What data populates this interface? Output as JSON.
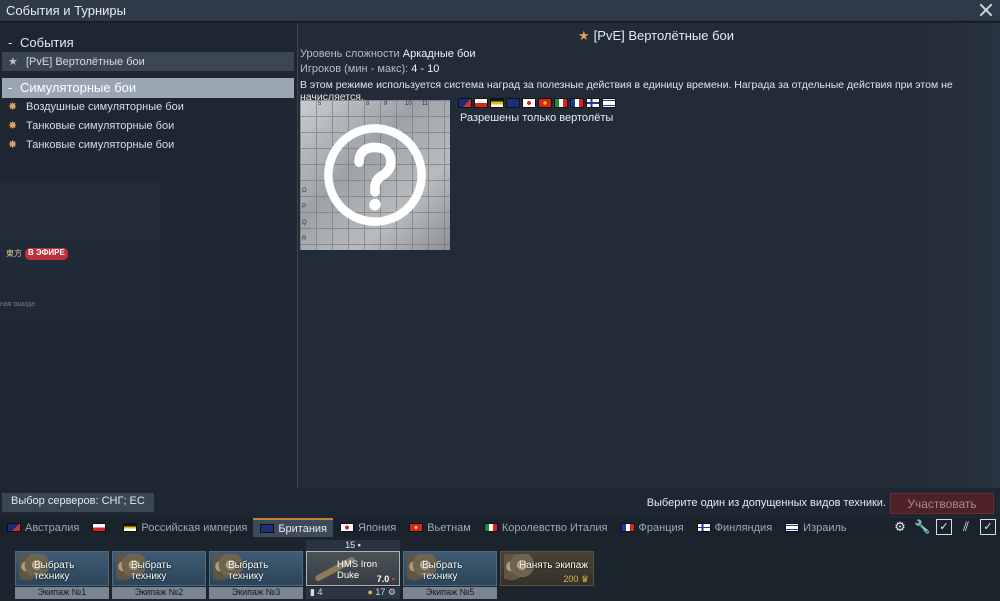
{
  "window": {
    "title": "События и Турниры"
  },
  "left_panel": {
    "sections": [
      {
        "label": "События",
        "items": [
          {
            "label": "[PvE] Вертолётные бои",
            "selected": true
          }
        ]
      },
      {
        "label": "Симуляторные бои",
        "active": true,
        "items": [
          {
            "label": "Воздушные симуляторные бои"
          },
          {
            "label": "Танковые симуляторные бои"
          },
          {
            "label": "Танковые симуляторные бои"
          }
        ]
      }
    ],
    "stream": {
      "brand": "東方",
      "status": "В ЭФИРЕ"
    },
    "error_text": "ная ошида"
  },
  "event": {
    "title": "[PvE] Вертолётные бои",
    "difficulty_label": "Уровень сложности",
    "difficulty_value": "Аркадные бои",
    "players_label": "Игроков (мин - макс):",
    "players_value": "4 - 10",
    "description": "В этом режиме используется система наград за полезные действия в единицу времени. Награда за отдельные действия при этом не начисляется.",
    "restriction": "Разрешены только вертолёты",
    "map_col_labels": [
      "5",
      "8",
      "9",
      "10",
      "11"
    ],
    "map_row_labels": [
      "O",
      "P",
      "Q",
      "R"
    ],
    "allowed_flags": [
      "australia",
      "poland",
      "russia-empire",
      "britain",
      "japan",
      "vietnam",
      "italy",
      "france",
      "finland",
      "israel"
    ]
  },
  "bottom": {
    "server_button": "Выбор серверов: СНГ; ЕС",
    "hint": "Выберите один из допущенных видов техники.",
    "participate_button": "Участвовать"
  },
  "nations": [
    {
      "label": "Австралия",
      "flag": "australia"
    },
    {
      "label": "",
      "flag": "poland"
    },
    {
      "label": "Российская империя",
      "flag": "russia-empire"
    },
    {
      "label": "Британия",
      "flag": "britain",
      "active": true
    },
    {
      "label": "Япония",
      "flag": "japan"
    },
    {
      "label": "Вьетнам",
      "flag": "vietnam"
    },
    {
      "label": "Королевство Италия",
      "flag": "italy"
    },
    {
      "label": "Франция",
      "flag": "france"
    },
    {
      "label": "Финляндия",
      "flag": "finland"
    },
    {
      "label": "Израиль",
      "flag": "israel"
    }
  ],
  "crew_slots": [
    {
      "type": "empty",
      "label": "Выбрать технику",
      "crew": "Экипаж №1"
    },
    {
      "type": "empty",
      "label": "Выбрать технику",
      "crew": "Экипаж №2"
    },
    {
      "type": "empty",
      "label": "Выбрать технику",
      "crew": "Экипаж №3"
    },
    {
      "type": "vehicle",
      "vehicle": "HMS Iron Duke",
      "badge": "15",
      "br": "7.0",
      "crew_num": "4",
      "stat": "17"
    },
    {
      "type": "empty",
      "label": "Выбрать технику",
      "crew": "Экипаж №5"
    },
    {
      "type": "hire",
      "label": "Нанять экипаж",
      "cost": "200"
    }
  ],
  "colors": {
    "accent": "#c7823a",
    "participate_bg": "#4e2125",
    "star": "#e0a15d"
  }
}
